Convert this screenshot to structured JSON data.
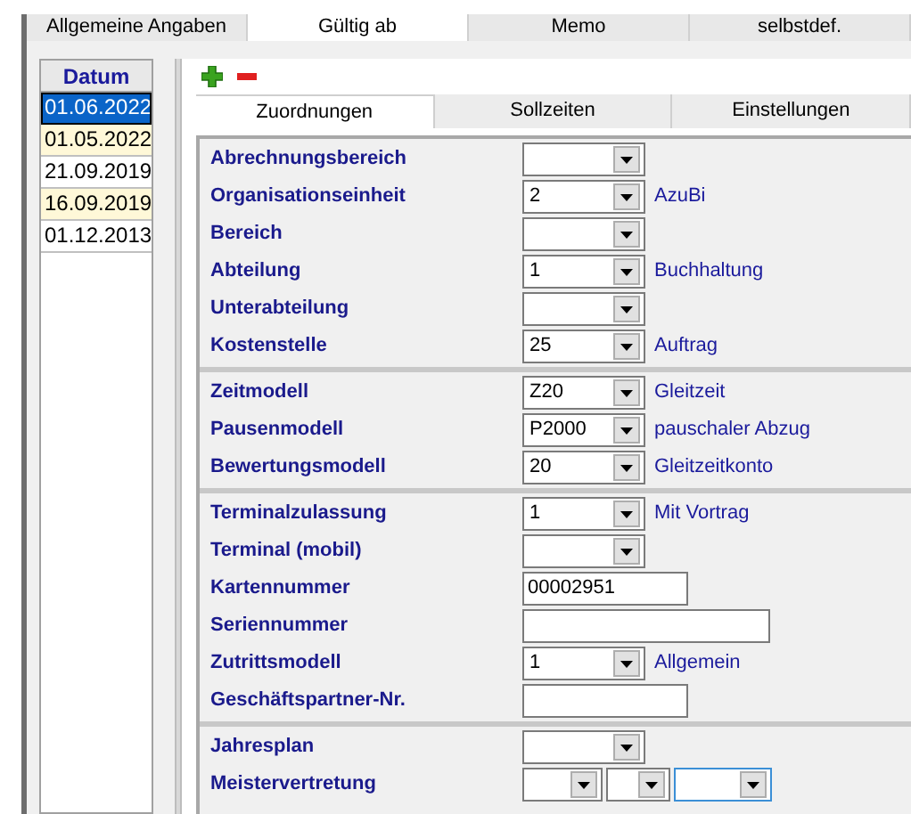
{
  "top_tabs": [
    {
      "label": "Allgemeine Angaben",
      "selected": false
    },
    {
      "label": "Gültig ab",
      "selected": true
    },
    {
      "label": "Memo",
      "selected": false
    },
    {
      "label": "selbstdef.",
      "selected": false
    }
  ],
  "dates": {
    "header": "Datum",
    "items": [
      {
        "label": "01.06.2022",
        "selected": true
      },
      {
        "label": "01.05.2022",
        "selected": false,
        "highlighted": true
      },
      {
        "label": "21.09.2019",
        "selected": false,
        "highlighted": false
      },
      {
        "label": "16.09.2019",
        "selected": false,
        "highlighted": true
      },
      {
        "label": "01.12.2013",
        "selected": false,
        "highlighted": false
      }
    ]
  },
  "sub_tabs": [
    {
      "label": "Zuordnungen",
      "selected": true
    },
    {
      "label": "Sollzeiten",
      "selected": false
    },
    {
      "label": "Einstellungen",
      "selected": false
    }
  ],
  "sections": [
    {
      "rows": [
        {
          "kind": "combo",
          "label": "Abrechnungsbereich"
        },
        {
          "kind": "combo",
          "label": "Organisationseinheit",
          "value": "2",
          "description": "AzuBi"
        },
        {
          "kind": "combo",
          "label": "Bereich"
        },
        {
          "kind": "combo",
          "label": "Abteilung",
          "value": "1",
          "description": "Buchhaltung"
        },
        {
          "kind": "combo",
          "label": "Unterabteilung"
        },
        {
          "kind": "combo",
          "label": "Kostenstelle",
          "value": "25",
          "description": "Auftrag"
        }
      ]
    },
    {
      "rows": [
        {
          "kind": "combo",
          "label": "Zeitmodell",
          "value": "Z20",
          "description": "Gleitzeit"
        },
        {
          "kind": "combo",
          "label": "Pausenmodell",
          "value": "P2000",
          "description": "pauschaler Abzug"
        },
        {
          "kind": "combo",
          "label": "Bewertungsmodell",
          "value": "20",
          "description": "Gleitzeitkonto"
        }
      ]
    },
    {
      "rows": [
        {
          "kind": "combo",
          "label": "Terminalzulassung",
          "value": "1",
          "description": "Mit Vortrag"
        },
        {
          "kind": "combo",
          "label": "Terminal (mobil)"
        },
        {
          "kind": "text",
          "label": "Kartennummer",
          "value": "00002951"
        },
        {
          "kind": "wide_text",
          "label": "Seriennummer"
        },
        {
          "kind": "combo",
          "label": "Zutrittsmodell",
          "value": "1",
          "description": "Allgemein"
        },
        {
          "kind": "text",
          "label": "Geschäftspartner-Nr."
        }
      ]
    },
    {
      "rows": [
        {
          "kind": "combo",
          "label": "Jahresplan"
        },
        {
          "kind": "multi",
          "label": "Meistervertretung",
          "combos": [
            {
              "focused": false
            },
            {
              "focused": false
            },
            {
              "focused": true
            }
          ]
        }
      ]
    }
  ]
}
